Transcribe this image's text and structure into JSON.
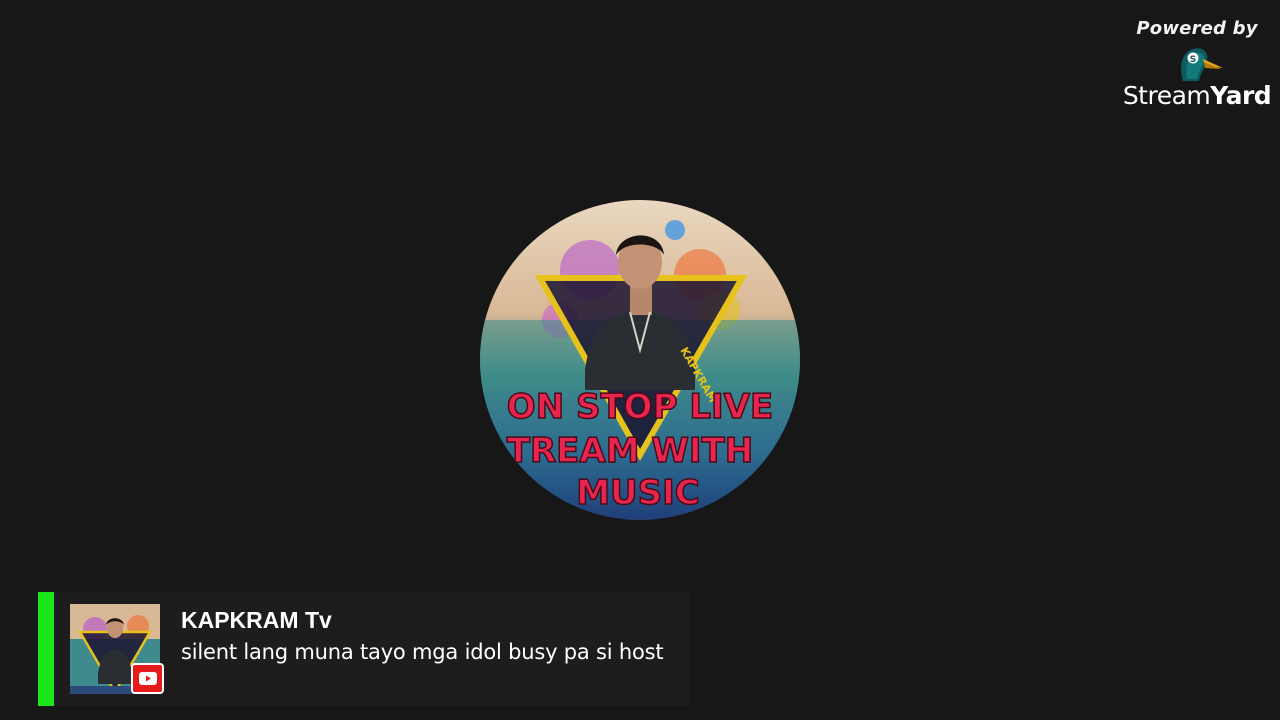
{
  "branding": {
    "powered_by": "Powered by",
    "brand_part1": "Stream",
    "brand_part2": "Yard",
    "logo_icon": "streamyard-duck-icon"
  },
  "stream_avatar": {
    "icon": "channel-avatar-image",
    "overlay_lines": [
      "ON STOP LIVE",
      "TREAM WITH",
      "MUSIC"
    ],
    "neck_tag": "KAPKRAM"
  },
  "comment": {
    "author": "KAPKRAM Tv",
    "message": "silent lang muna tayo mga idol busy pa si host",
    "platform_icon": "youtube-icon",
    "accent_color": "#19e61b"
  },
  "colors": {
    "background": "#171717",
    "banner": "#1d1d1d",
    "youtube_red": "#e61b1b"
  }
}
